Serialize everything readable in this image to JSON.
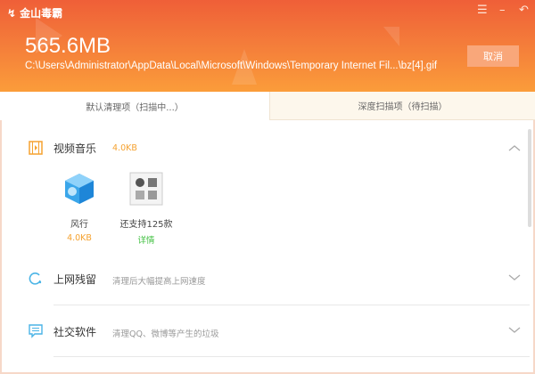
{
  "app": {
    "title": "金山毒霸",
    "icons": [
      "menu-icon",
      "minimize-icon",
      "close-icon"
    ]
  },
  "scan": {
    "size": "565.6MB",
    "current_path": "C:\\Users\\Administrator\\AppData\\Local\\Microsoft\\Windows\\Temporary Internet Fil...\\bz[4].gif",
    "cancel_label": "取消"
  },
  "tabs": [
    {
      "label": "默认清理项（扫描中...）",
      "active": true
    },
    {
      "label": "深度扫描项（待扫描）",
      "active": false
    }
  ],
  "sections": [
    {
      "title": "视频音乐",
      "size": "4.0KB",
      "icon": "film-icon",
      "expanded": true,
      "apps": [
        {
          "name": "风行",
          "size": "4.0KB"
        },
        {
          "name": "还支持125款",
          "link": "详情"
        }
      ]
    },
    {
      "title": "上网残留",
      "subtitle": "清理后大幅提高上网速度",
      "icon": "refresh-icon",
      "expanded": false
    },
    {
      "title": "社交软件",
      "subtitle": "清理QQ、微博等产生的垃圾",
      "icon": "chat-icon",
      "expanded": false
    }
  ],
  "colors": {
    "header_top": "#ef5f38",
    "header_bottom": "#fb9d3a",
    "accent_orange": "#f5a230",
    "link_green": "#3cbf3c",
    "icon_blue": "#4ab4e6"
  }
}
